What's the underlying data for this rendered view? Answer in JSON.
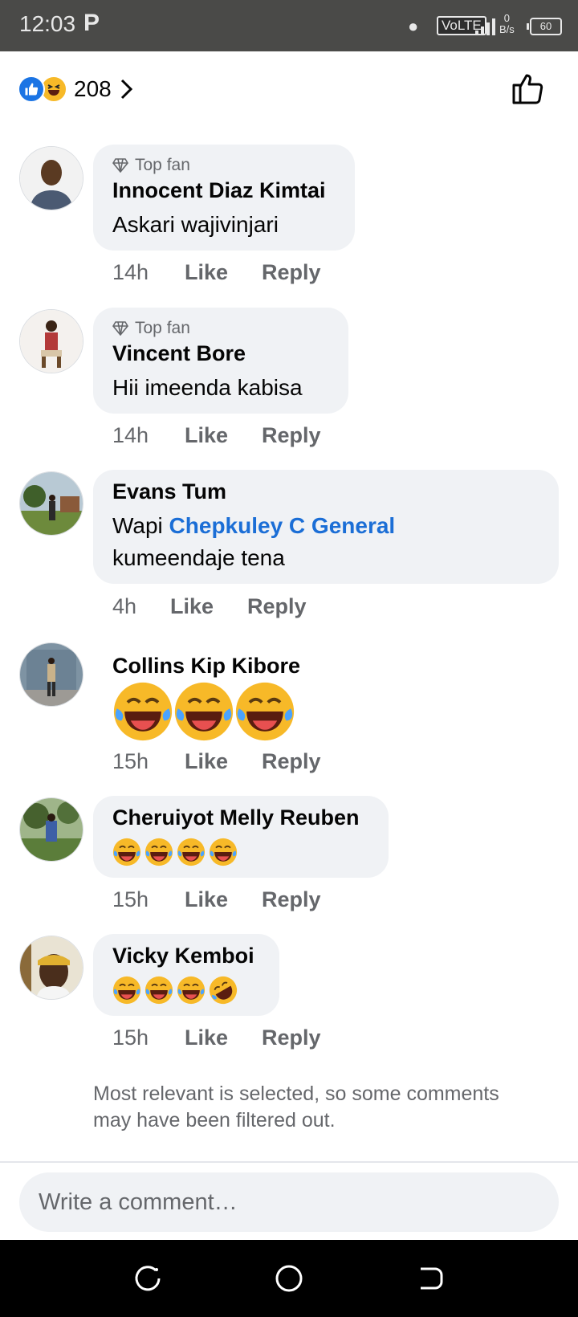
{
  "status_bar": {
    "time": "12:03",
    "app_indicator": "P",
    "network_type": "VoLTE",
    "data_speed_value": "0",
    "data_speed_unit": "B/s",
    "battery_level": "60"
  },
  "reactions": {
    "count": "208",
    "types": [
      "like-icon",
      "haha-icon"
    ]
  },
  "comments": [
    {
      "badge": "Top fan",
      "author": "Innocent Diaz Kimtai",
      "text": "Askari wajivinjari",
      "time": "14h",
      "like": "Like",
      "reply": "Reply"
    },
    {
      "badge": "Top fan",
      "author": "Vincent Bore",
      "text": "Hii imeenda kabisa",
      "time": "14h",
      "like": "Like",
      "reply": "Reply"
    },
    {
      "author": "Evans Tum",
      "text_prefix": "Wapi",
      "mention": "Chepkuley C General",
      "text_line2": "kumeendaje tena",
      "time": "4h",
      "like": "Like",
      "reply": "Reply"
    },
    {
      "author": "Collins Kip Kibore",
      "emoji_count": 3,
      "time": "15h",
      "like": "Like",
      "reply": "Reply"
    },
    {
      "author": "Cheruiyot Melly Reuben",
      "emoji_count": 4,
      "time": "15h",
      "like": "Like",
      "reply": "Reply"
    },
    {
      "author": "Vicky Kemboi",
      "emoji_count": 4,
      "time": "15h",
      "like": "Like",
      "reply": "Reply"
    }
  ],
  "filter_note": "Most relevant is selected, so some comments may have been filtered out.",
  "composer": {
    "placeholder": "Write a comment…"
  },
  "colors": {
    "accent": "#1b74e4",
    "mention": "#1b6ed6",
    "bubble": "#f0f2f5",
    "secondary_text": "#65676b",
    "emoji": "#f7b928"
  }
}
